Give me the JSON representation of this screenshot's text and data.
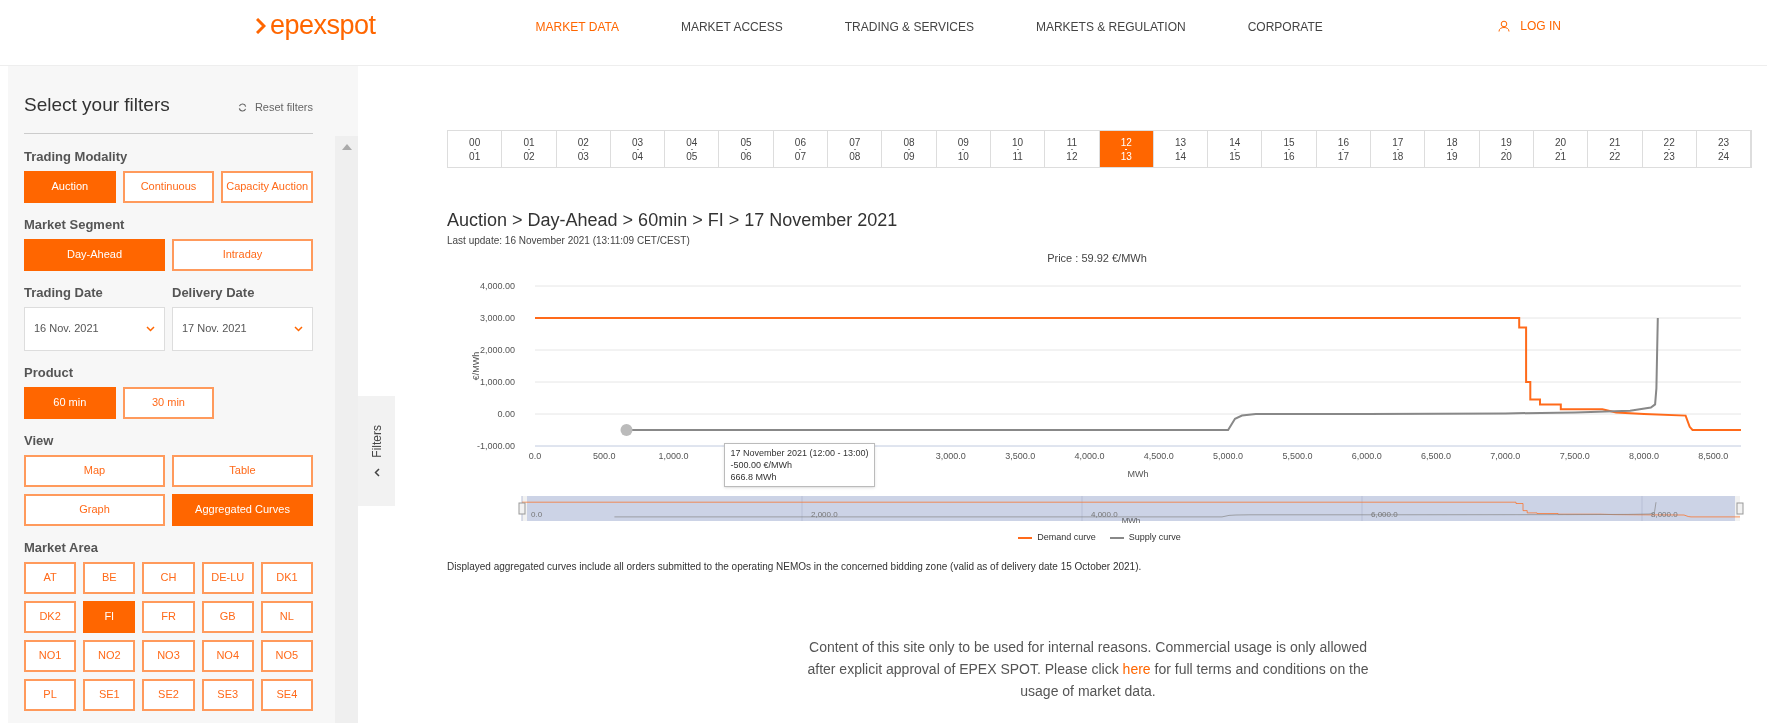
{
  "header": {
    "logo": "epexspot",
    "nav": [
      {
        "label": "MARKET DATA",
        "selected": true
      },
      {
        "label": "MARKET ACCESS",
        "selected": false
      },
      {
        "label": "TRADING & SERVICES",
        "selected": false
      },
      {
        "label": "MARKETS & REGULATION",
        "selected": false
      },
      {
        "label": "CORPORATE",
        "selected": false
      }
    ],
    "login": "LOG IN"
  },
  "sidebar": {
    "title": "Select your filters",
    "reset": "Reset filters",
    "tab": "Filters",
    "groups": [
      {
        "kind": "buttons",
        "label": "Trading Modality",
        "options": [
          {
            "label": "Auction",
            "selected": true
          },
          {
            "label": "Continuous",
            "selected": false
          },
          {
            "label": "Capacity Auction",
            "selected": false
          }
        ]
      },
      {
        "kind": "buttons",
        "label": "Market Segment",
        "options": [
          {
            "label": "Day-Ahead",
            "selected": true
          },
          {
            "label": "Intraday",
            "selected": false
          }
        ]
      },
      {
        "kind": "dates",
        "fields": [
          {
            "label": "Trading Date",
            "value": "16 Nov. 2021"
          },
          {
            "label": "Delivery Date",
            "value": "17 Nov. 2021"
          }
        ]
      },
      {
        "kind": "short-buttons",
        "label": "Product",
        "options": [
          {
            "label": "60 min",
            "selected": true
          },
          {
            "label": "30 min",
            "selected": false
          }
        ]
      },
      {
        "kind": "buttons",
        "label": "View",
        "options": [
          {
            "label": "Map",
            "selected": false
          },
          {
            "label": "Table",
            "selected": false
          },
          {
            "label": "Graph",
            "selected": false
          },
          {
            "label": "Aggregated Curves",
            "selected": true
          }
        ]
      },
      {
        "kind": "buttons",
        "label": "Market Area",
        "options": [
          {
            "label": "AT",
            "selected": false
          },
          {
            "label": "BE",
            "selected": false
          },
          {
            "label": "CH",
            "selected": false
          },
          {
            "label": "DE-LU",
            "selected": false
          },
          {
            "label": "DK1",
            "selected": false
          },
          {
            "label": "DK2",
            "selected": false
          },
          {
            "label": "FI",
            "selected": true
          },
          {
            "label": "FR",
            "selected": false
          },
          {
            "label": "GB",
            "selected": false
          },
          {
            "label": "NL",
            "selected": false
          },
          {
            "label": "NO1",
            "selected": false
          },
          {
            "label": "NO2",
            "selected": false
          },
          {
            "label": "NO3",
            "selected": false
          },
          {
            "label": "NO4",
            "selected": false
          },
          {
            "label": "NO5",
            "selected": false
          },
          {
            "label": "PL",
            "selected": false
          },
          {
            "label": "SE1",
            "selected": false
          },
          {
            "label": "SE2",
            "selected": false
          },
          {
            "label": "SE3",
            "selected": false
          },
          {
            "label": "SE4",
            "selected": false
          }
        ]
      }
    ]
  },
  "hours": [
    {
      "from": "00",
      "to": "01",
      "selected": false
    },
    {
      "from": "01",
      "to": "02",
      "selected": false
    },
    {
      "from": "02",
      "to": "03",
      "selected": false
    },
    {
      "from": "03",
      "to": "04",
      "selected": false
    },
    {
      "from": "04",
      "to": "05",
      "selected": false
    },
    {
      "from": "05",
      "to": "06",
      "selected": false
    },
    {
      "from": "06",
      "to": "07",
      "selected": false
    },
    {
      "from": "07",
      "to": "08",
      "selected": false
    },
    {
      "from": "08",
      "to": "09",
      "selected": false
    },
    {
      "from": "09",
      "to": "10",
      "selected": false
    },
    {
      "from": "10",
      "to": "11",
      "selected": false
    },
    {
      "from": "11",
      "to": "12",
      "selected": false
    },
    {
      "from": "12",
      "to": "13",
      "selected": true
    },
    {
      "from": "13",
      "to": "14",
      "selected": false
    },
    {
      "from": "14",
      "to": "15",
      "selected": false
    },
    {
      "from": "15",
      "to": "16",
      "selected": false
    },
    {
      "from": "16",
      "to": "17",
      "selected": false
    },
    {
      "from": "17",
      "to": "18",
      "selected": false
    },
    {
      "from": "18",
      "to": "19",
      "selected": false
    },
    {
      "from": "19",
      "to": "20",
      "selected": false
    },
    {
      "from": "20",
      "to": "21",
      "selected": false
    },
    {
      "from": "21",
      "to": "22",
      "selected": false
    },
    {
      "from": "22",
      "to": "23",
      "selected": false
    },
    {
      "from": "23",
      "to": "24",
      "selected": false
    }
  ],
  "heading": "Auction > Day-Ahead > 60min > FI > 17 November 2021",
  "last_update": "Last update: 16 November 2021 (13:11:09 CET/CEST)",
  "chart_data": {
    "type": "line",
    "grid": true,
    "title": "Price : 59.92 €/MWh",
    "xlabel": "MWh",
    "ylabel": "€/MWh",
    "xlim": [
      0,
      8700
    ],
    "ylim": [
      -1000,
      4000
    ],
    "xticks": [
      {
        "value": 0,
        "label": "0.0"
      },
      {
        "value": 500,
        "label": "500.0"
      },
      {
        "value": 1000,
        "label": "1,000.0"
      },
      {
        "value": 3000,
        "label": "3,000.0"
      },
      {
        "value": 3500,
        "label": "3,500.0"
      },
      {
        "value": 4000,
        "label": "4,000.0"
      },
      {
        "value": 4500,
        "label": "4,500.0"
      },
      {
        "value": 5000,
        "label": "5,000.0"
      },
      {
        "value": 5500,
        "label": "5,500.0"
      },
      {
        "value": 6000,
        "label": "6,000.0"
      },
      {
        "value": 6500,
        "label": "6,500.0"
      },
      {
        "value": 7000,
        "label": "7,000.0"
      },
      {
        "value": 7500,
        "label": "7,500.0"
      },
      {
        "value": 8000,
        "label": "8,000.0"
      },
      {
        "value": 8500,
        "label": "8,500.0"
      }
    ],
    "yticks": [
      {
        "value": 4000,
        "label": "4,000.00"
      },
      {
        "value": 3000,
        "label": "3,000.00"
      },
      {
        "value": 2000,
        "label": "2,000.00"
      },
      {
        "value": 1000,
        "label": "1,000.00"
      },
      {
        "value": 0,
        "label": "0.00"
      },
      {
        "value": -1000,
        "label": "-1,000.00"
      }
    ],
    "series": [
      {
        "name": "Demand curve",
        "color": "#ff6a1a",
        "x": [
          0,
          7100,
          7100,
          7150,
          7150,
          7180,
          7180,
          7250,
          7250,
          7400,
          7400,
          7700,
          7800,
          8000,
          8300,
          8330,
          8350,
          8700
        ],
        "values": [
          3000,
          3000,
          2700,
          2700,
          1000,
          1000,
          450,
          450,
          300,
          300,
          150,
          150,
          50,
          0,
          -50,
          -400,
          -500,
          -500
        ]
      },
      {
        "name": "Supply curve",
        "color": "#888888",
        "x": [
          660,
          5000,
          5050,
          5100,
          5200,
          6000,
          7000,
          7500,
          7900,
          8050,
          8080,
          8090,
          8100
        ],
        "values": [
          -500,
          -500,
          -150,
          -50,
          0,
          0,
          20,
          50,
          100,
          200,
          300,
          800,
          3000
        ]
      }
    ]
  },
  "tooltip": {
    "lines": [
      "17 November 2021 (12:00 - 13:00)",
      "-500.00 €/MWh",
      "666.8 MWh"
    ]
  },
  "navigator": {
    "labels": [
      "0.0",
      "2,000.0",
      "4,000.0",
      "6,000.0",
      "8,000.0"
    ],
    "unit": "MWh"
  },
  "note": "Displayed aggregated curves include all orders submitted to the operating NEMOs in the concerned bidding zone (valid as of delivery date 15 October 2021).",
  "disclaimer": {
    "before": "Content of this site only to be used for internal reasons. Commercial usage is only allowed after explicit approval of EPEX SPOT. Please click",
    "link": "here",
    "after": "for full terms and conditions on the usage of market data."
  }
}
